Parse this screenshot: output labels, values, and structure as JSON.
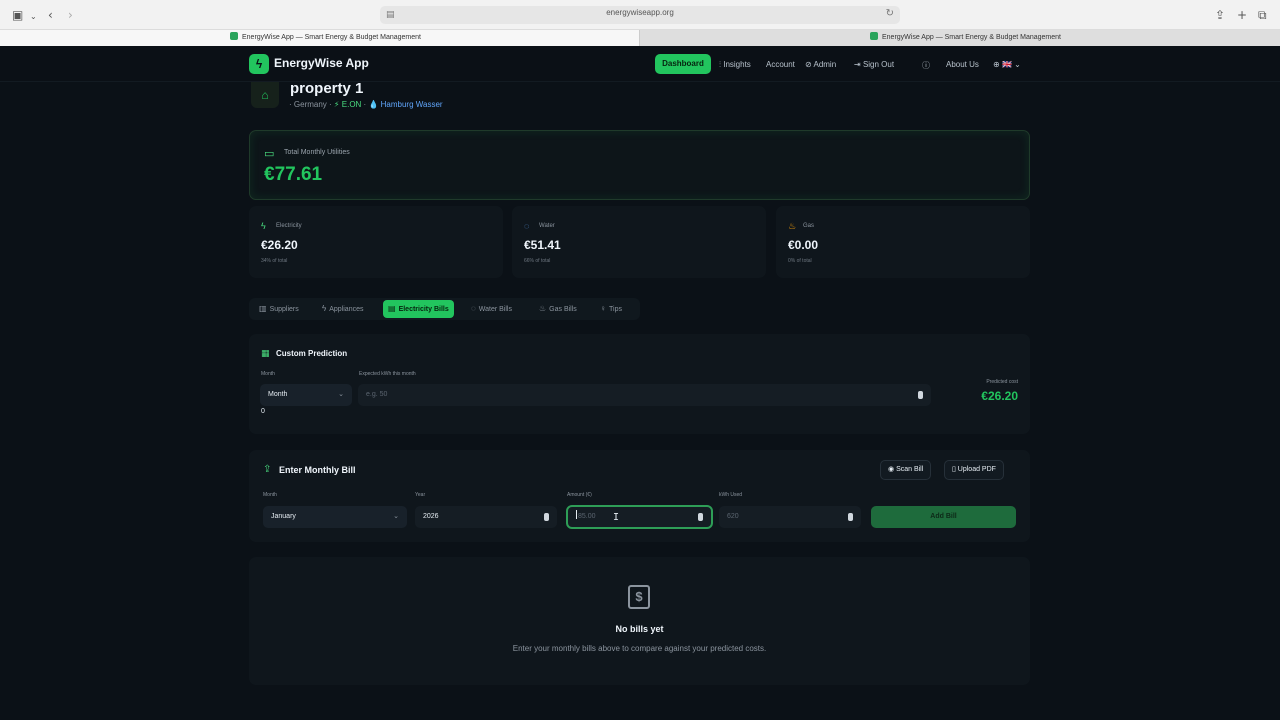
{
  "browser": {
    "url": "energywiseapp.org",
    "tabs": [
      {
        "title": "EnergyWise App — Smart Energy & Budget Management"
      },
      {
        "title": "EnergyWise App — Smart Energy & Budget Management"
      }
    ]
  },
  "nav": {
    "brand": "EnergyWise App",
    "dashboard": "Dashboard",
    "insights": "Insights",
    "account": "Account",
    "admin": "Admin",
    "sign_out": "Sign Out",
    "about": "About Us",
    "lang_flag": "🇬🇧"
  },
  "property": {
    "title": "property 1",
    "country": "Germany",
    "electricity_supplier": "E.ON",
    "water_supplier": "Hamburg Wasser"
  },
  "total": {
    "label": "Total Monthly Utilities",
    "value": "€77.61"
  },
  "stats": [
    {
      "label": "Electricity",
      "value": "€26.20",
      "share": "34% of total",
      "icon": "bolt-icon",
      "color": "#4ade80"
    },
    {
      "label": "Water",
      "value": "€51.41",
      "share": "66% of total",
      "icon": "water-icon",
      "color": "#60a5fa"
    },
    {
      "label": "Gas",
      "value": "€0.00",
      "share": "0% of total",
      "icon": "flame-icon",
      "color": "#f59e0b"
    }
  ],
  "tabs": [
    {
      "label": "Suppliers"
    },
    {
      "label": "Appliances"
    },
    {
      "label": "Electricity Bills",
      "active": true
    },
    {
      "label": "Water Bills"
    },
    {
      "label": "Gas Bills"
    },
    {
      "label": "Tips"
    }
  ],
  "prediction": {
    "title": "Custom Prediction",
    "month_label": "Month",
    "month_value": "Month",
    "kwh_label": "Expected kWh this month",
    "kwh_placeholder": "e.g. 50",
    "zero": "0",
    "predicted_label": "Predicted cost",
    "predicted_value": "€26.20"
  },
  "bill": {
    "title": "Enter Monthly Bill",
    "scan": "Scan Bill",
    "upload": "Upload PDF",
    "month_label": "Month",
    "month_value": "January",
    "year_label": "Year",
    "year_value": "2026",
    "amount_label": "Amount (€)",
    "amount_placeholder": "85.00",
    "kwh_label": "kWh Used",
    "kwh_placeholder": "620",
    "add": "Add Bill"
  },
  "empty": {
    "title": "No bills yet",
    "desc": "Enter your monthly bills above to compare against your predicted costs."
  }
}
